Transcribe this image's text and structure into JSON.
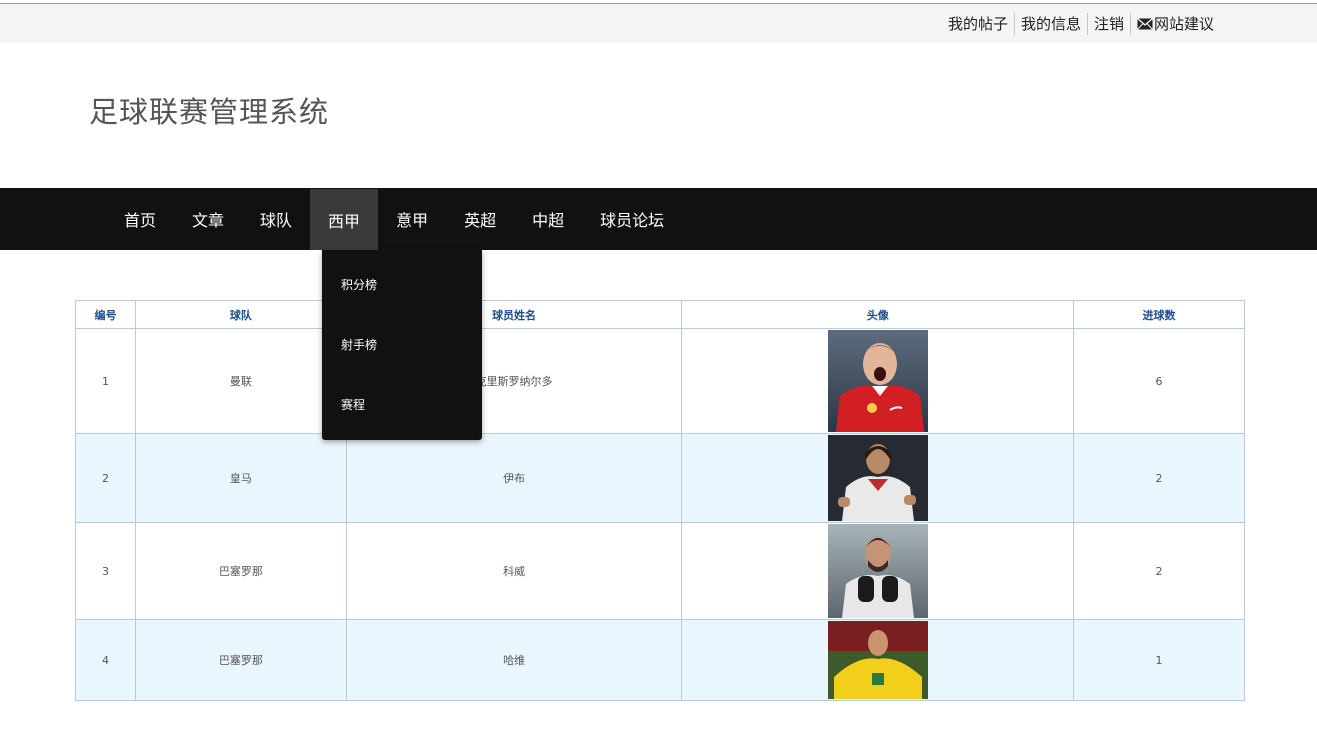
{
  "header": {
    "links": [
      "我的帖子",
      "我的信息",
      "注销",
      "网站建议"
    ],
    "mail_icon": "mail-icon",
    "site_title": "足球联赛管理系统"
  },
  "nav": {
    "items": [
      "首页",
      "文章",
      "球队",
      "西甲",
      "意甲",
      "英超",
      "中超",
      "球员论坛"
    ],
    "active": "西甲",
    "dropdown": [
      "积分榜",
      "射手榜",
      "赛程"
    ]
  },
  "table": {
    "headers": [
      "编号",
      "球队",
      "球员姓名",
      "头像",
      "进球数"
    ],
    "rows": [
      {
        "id": "1",
        "team": "曼联",
        "name": "克里斯罗纳尔多",
        "goals": "6"
      },
      {
        "id": "2",
        "team": "皇马",
        "name": "伊布",
        "goals": "2"
      },
      {
        "id": "3",
        "team": "巴塞罗那",
        "name": "科威",
        "goals": "2"
      },
      {
        "id": "4",
        "team": "巴塞罗那",
        "name": "哈维",
        "goals": "1"
      }
    ]
  },
  "colors": {
    "nav_bg": "#111111",
    "nav_active": "#3a3a3a",
    "header_text": "#1f4e8c",
    "row_alt": "#eaf6fd",
    "border": "#b9cbd8"
  }
}
